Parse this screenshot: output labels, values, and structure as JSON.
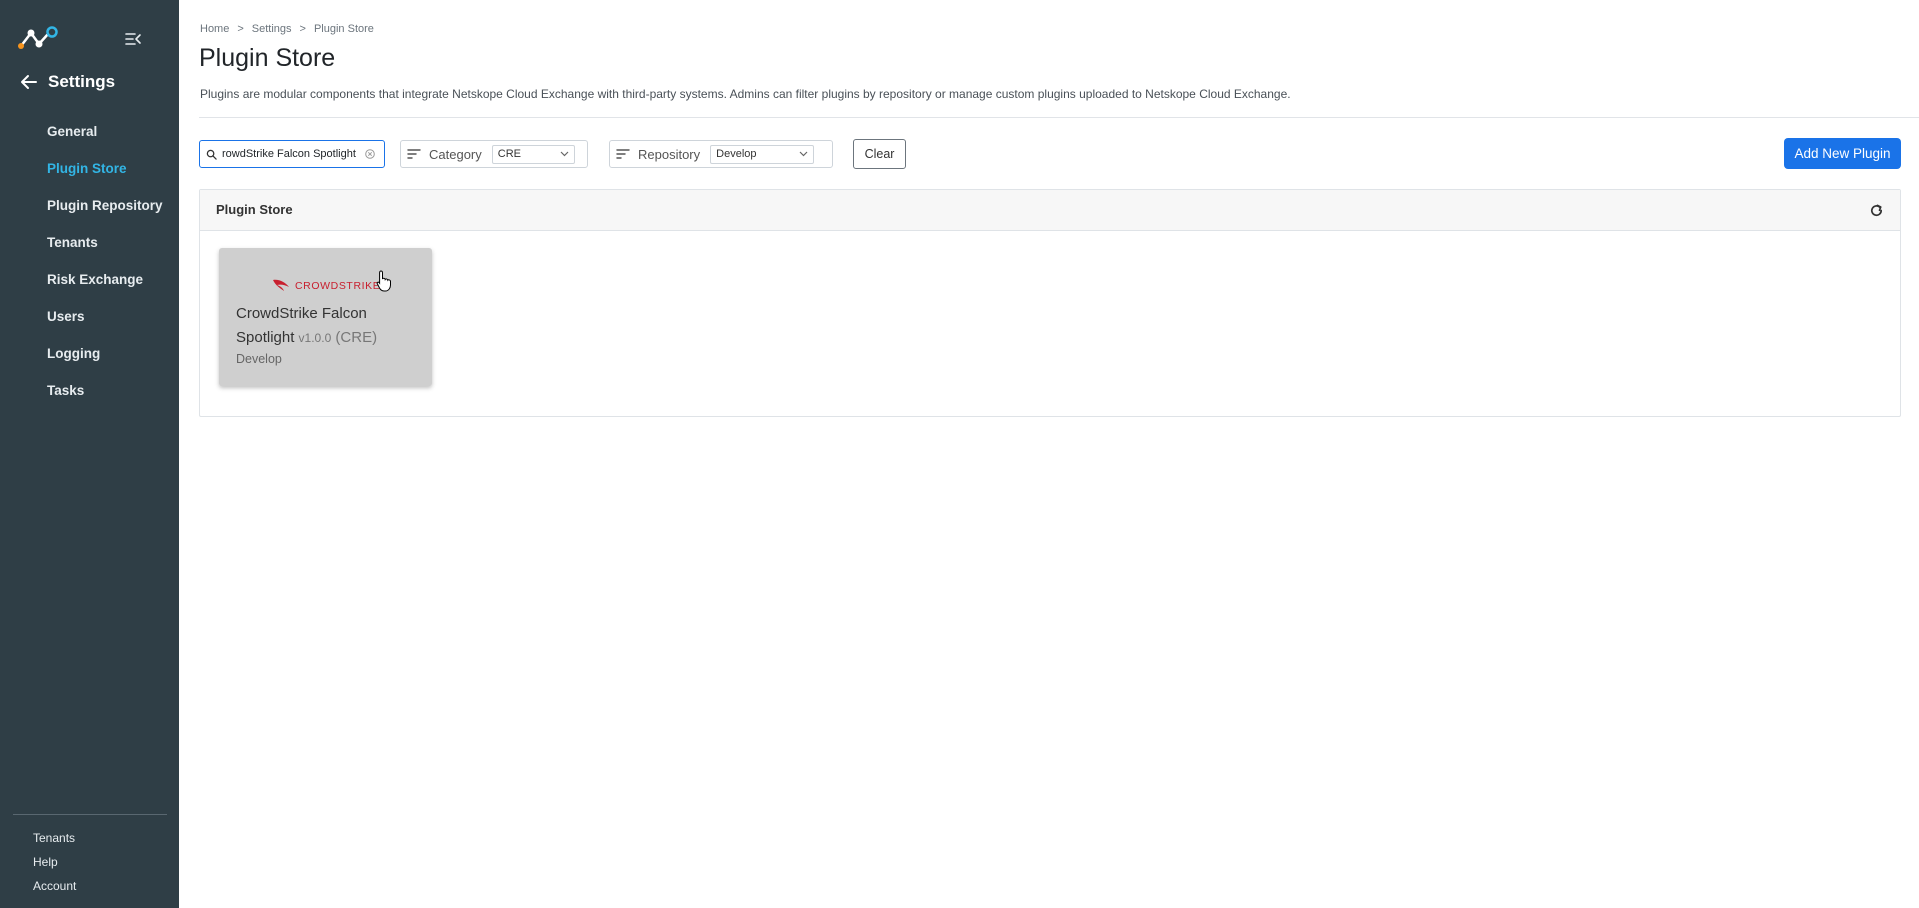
{
  "sidebar": {
    "section_title": "Settings",
    "items": [
      {
        "label": "General",
        "active": false
      },
      {
        "label": "Plugin Store",
        "active": true
      },
      {
        "label": "Plugin Repository",
        "active": false
      },
      {
        "label": "Tenants",
        "active": false
      },
      {
        "label": "Risk Exchange",
        "active": false
      },
      {
        "label": "Users",
        "active": false
      },
      {
        "label": "Logging",
        "active": false
      },
      {
        "label": "Tasks",
        "active": false
      }
    ],
    "bottom_links": [
      "Tenants",
      "Help",
      "Account"
    ],
    "active_color": "#32b5e5",
    "bg_color": "#2f3e46"
  },
  "breadcrumb": [
    "Home",
    "Settings",
    "Plugin Store"
  ],
  "breadcrumb_separator": ">",
  "page": {
    "title": "Plugin Store",
    "description": "Plugins are modular components that integrate Netskope Cloud Exchange with third-party systems. Admins can filter plugins by repository or manage custom plugins uploaded to Netskope Cloud Exchange."
  },
  "filters": {
    "search_value": "rowdStrike Falcon Spotlight",
    "category_label": "Category",
    "category_value": "CRE",
    "repository_label": "Repository",
    "repository_value": "Develop",
    "clear_label": "Clear"
  },
  "add_button_label": "Add New Plugin",
  "accent_color": "#1a73e8",
  "panel": {
    "title": "Plugin Store"
  },
  "plugins": [
    {
      "logo_text": "CROWDSTRIKE",
      "name": "CrowdStrike Falcon Spotlight",
      "version": "v1.0.0",
      "category": "(CRE)",
      "repository": "Develop"
    }
  ],
  "icons": {
    "logo": "netskope-logo-icon",
    "collapse": "collapse-menu-icon",
    "back": "arrow-left-icon",
    "search": "search-icon",
    "clear": "clear-circle-icon",
    "filter": "sort-filter-icon",
    "chevron": "chevron-down-icon",
    "refresh": "refresh-icon"
  }
}
